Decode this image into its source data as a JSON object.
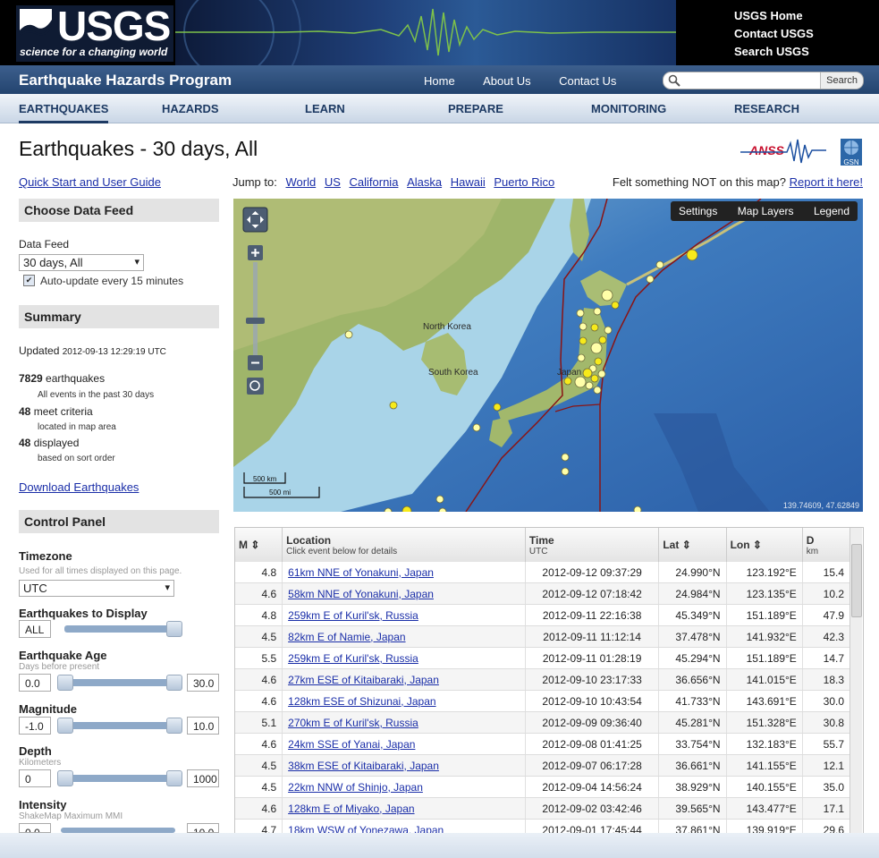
{
  "header": {
    "logo_text": "USGS",
    "logo_tagline": "science for a changing world",
    "links": [
      "USGS Home",
      "Contact USGS",
      "Search USGS"
    ],
    "program": "Earthquake Hazards Program",
    "program_links": [
      "Home",
      "About Us",
      "Contact Us"
    ],
    "search_button": "Search",
    "nav": [
      "EARTHQUAKES",
      "HAZARDS",
      "LEARN",
      "PREPARE",
      "MONITORING",
      "RESEARCH"
    ]
  },
  "page": {
    "title": "Earthquakes - 30 days, All",
    "anss_logo": "ANSS",
    "gsn_logo": "GSN",
    "quick_start": "Quick Start and User Guide"
  },
  "sidebar": {
    "choose_feed": "Choose Data Feed",
    "data_feed_label": "Data Feed",
    "data_feed_value": "30 days, All",
    "auto_update": "Auto-update every 15 minutes",
    "summary_head": "Summary",
    "updated_label": "Updated",
    "updated_value": "2012-09-13 12:29:19 UTC",
    "count_total": "7829",
    "count_total_label": "earthquakes",
    "count_total_sub": "All events in the past 30 days",
    "count_meet": "48",
    "count_meet_label": "meet criteria",
    "count_meet_sub": "located in map area",
    "count_disp": "48",
    "count_disp_label": "displayed",
    "count_disp_sub": "based on sort order",
    "download": "Download Earthquakes",
    "control_head": "Control Panel",
    "timezone_label": "Timezone",
    "timezone_hint": "Used for all times displayed on this page.",
    "timezone_value": "UTC",
    "display_label": "Earthquakes to Display",
    "display_value": "ALL",
    "age_label": "Earthquake Age",
    "age_hint": "Days before present",
    "age_min": "0.0",
    "age_max": "30.0",
    "mag_label": "Magnitude",
    "mag_min": "-1.0",
    "mag_max": "10.0",
    "depth_label": "Depth",
    "depth_hint": "Kilometers",
    "depth_min": "0",
    "depth_max": "1000",
    "intensity_label": "Intensity",
    "intensity_hint": "ShakeMap Maximum MMI",
    "intensity_min": "0.0",
    "intensity_max": "10.0"
  },
  "map": {
    "jump_label": "Jump to:",
    "jump_links": [
      "World",
      "US",
      "California",
      "Alaska",
      "Hawaii",
      "Puerto Rico"
    ],
    "felt_text": "Felt something NOT on this map?",
    "felt_link": "Report it here!",
    "buttons": [
      "Settings",
      "Map Layers",
      "Legend"
    ],
    "labels": [
      "North Korea",
      "South Korea",
      "Japan"
    ],
    "scale_km": "500 km",
    "scale_mi": "500 mi",
    "coords": "139.74609, 47.62849"
  },
  "table": {
    "columns": [
      {
        "name": "M",
        "sub": ""
      },
      {
        "name": "Location",
        "sub": "Click event below for details"
      },
      {
        "name": "Time",
        "sub": "UTC"
      },
      {
        "name": "Lat",
        "sub": ""
      },
      {
        "name": "Lon",
        "sub": ""
      },
      {
        "name": "D",
        "sub": "km"
      }
    ],
    "rows": [
      [
        "4.8",
        "61km NNE of Yonakuni, Japan",
        "2012-09-12 09:37:29",
        "24.990°N",
        "123.192°E",
        "15.4"
      ],
      [
        "4.6",
        "58km NNE of Yonakuni, Japan",
        "2012-09-12 07:18:42",
        "24.984°N",
        "123.135°E",
        "10.2"
      ],
      [
        "4.8",
        "259km E of Kuril'sk, Russia",
        "2012-09-11 22:16:38",
        "45.349°N",
        "151.189°E",
        "47.9"
      ],
      [
        "4.5",
        "82km E of Namie, Japan",
        "2012-09-11 11:12:14",
        "37.478°N",
        "141.932°E",
        "42.3"
      ],
      [
        "5.5",
        "259km E of Kuril'sk, Russia",
        "2012-09-11 01:28:19",
        "45.294°N",
        "151.189°E",
        "14.7"
      ],
      [
        "4.6",
        "27km ESE of Kitaibaraki, Japan",
        "2012-09-10 23:17:33",
        "36.656°N",
        "141.015°E",
        "18.3"
      ],
      [
        "4.6",
        "128km ESE of Shizunai, Japan",
        "2012-09-10 10:43:54",
        "41.733°N",
        "143.691°E",
        "30.0"
      ],
      [
        "5.1",
        "270km E of Kuril'sk, Russia",
        "2012-09-09 09:36:40",
        "45.281°N",
        "151.328°E",
        "30.8"
      ],
      [
        "4.6",
        "24km SSE of Yanai, Japan",
        "2012-09-08 01:41:25",
        "33.754°N",
        "132.183°E",
        "55.7"
      ],
      [
        "4.5",
        "38km ESE of Kitaibaraki, Japan",
        "2012-09-07 06:17:28",
        "36.661°N",
        "141.155°E",
        "12.1"
      ],
      [
        "4.5",
        "22km NNW of Shinjo, Japan",
        "2012-09-04 14:56:24",
        "38.929°N",
        "140.155°E",
        "35.0"
      ],
      [
        "4.6",
        "128km E of Miyako, Japan",
        "2012-09-02 03:42:46",
        "39.565°N",
        "143.477°E",
        "17.1"
      ],
      [
        "4.7",
        "18km WSW of Yonezawa, Japan",
        "2012-09-01 17:45:44",
        "37.861°N",
        "139.919°E",
        "29.6"
      ]
    ]
  },
  "colors": {
    "link": "#1a2ea8",
    "header_blue": "#23446f",
    "quake_marker": "#f5e61c"
  }
}
